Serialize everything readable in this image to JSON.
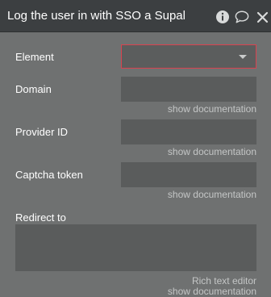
{
  "header": {
    "title": "Log the user in with SSO a Supal",
    "icons": [
      "info-icon",
      "comment-icon",
      "close-icon"
    ]
  },
  "fields": {
    "element": {
      "label": "Element",
      "value": ""
    },
    "domain": {
      "label": "Domain",
      "value": "",
      "doc": "show documentation"
    },
    "provider_id": {
      "label": "Provider ID",
      "value": "",
      "doc": "show documentation"
    },
    "captcha_token": {
      "label": "Captcha token",
      "value": "",
      "doc": "show documentation"
    },
    "redirect_to": {
      "label": "Redirect to",
      "value": "",
      "editor": "Rich text editor",
      "doc": "show documentation"
    }
  },
  "colors": {
    "panel": "#6f7171",
    "header": "#3c3f41",
    "input": "#5a5c5c",
    "error_border": "#d9424f"
  }
}
